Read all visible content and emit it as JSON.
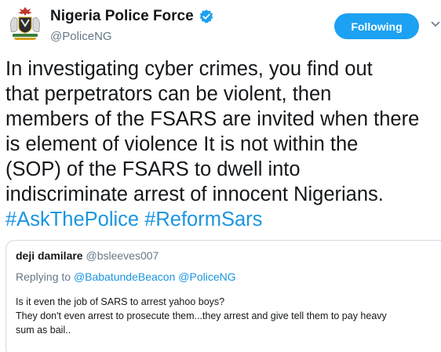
{
  "account": {
    "display_name": "Nigeria Police Force",
    "handle": "@PoliceNG",
    "verified": true,
    "avatar_icon": "nigeria-police-crest-icon"
  },
  "follow_button": {
    "label": "Following",
    "color": "#1da1f2"
  },
  "menu_icon": "chevron-down-icon",
  "tweet": {
    "lines": [
      "In investigating cyber crimes, you find out",
      "that perpetrators can be violent, then",
      "members of the FSARS are invited when there",
      "is element of violence  It is not within the",
      "(SOP) of the FSARS to dwell into",
      "indiscriminate arrest of innocent Nigerians."
    ],
    "hashtags": [
      "#AskThePolice",
      "#ReformSars"
    ],
    "link_color": "#1b95e0"
  },
  "quoted_tweet": {
    "name": "deji damilare",
    "handle": "@bsleeves007",
    "replying_prefix": "Replying to",
    "replying_to": [
      "@BabatundeBeacon",
      "@PoliceNG"
    ],
    "body_lines": [
      "Is it even the job of SARS to arrest yahoo boys?",
      "They don't even arrest to prosecute them...they arrest and give tell them to pay heavy",
      "sum as bail.."
    ]
  }
}
